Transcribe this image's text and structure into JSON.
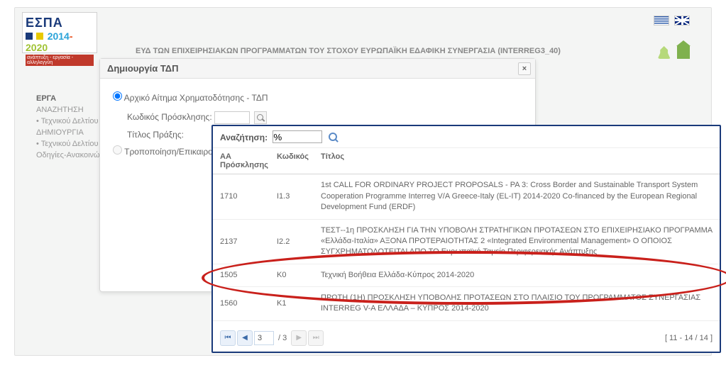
{
  "header": {
    "title": "ΕΥΔ ΤΩΝ ΕΠΙΧΕΙΡΗΣΙΑΚΩΝ ΠΡΟΓΡΑΜΜΑΤΩΝ ΤΟΥ ΣΤΟΧΟΥ ΕΥΡΩΠΑΪΚΗ ΕΔΑΦΙΚΗ ΣΥΝΕΡΓΑΣΙΑ (INTERREG3_40)",
    "logo_text": "ΕΣΠΑ",
    "logo_period": "2014-2020",
    "logo_tagline": "ανάπτυξη - εργασία - αλληλεγγύη"
  },
  "sidebar": {
    "heading": "ΕΡΓΑ",
    "items": [
      "ΑΝΑΖΗΤΗΣΗ",
      "• Τεχνικού Δελτίου",
      "ΔΗΜΙΟΥΡΓΙΑ",
      "• Τεχνικού Δελτίου",
      "Οδηγίες-Ανακοινώσ"
    ]
  },
  "modal": {
    "title": "Δημιουργία ΤΔΠ",
    "close": "×",
    "radio1": "Αρχικό Αίτημα Χρηματοδότησης - ΤΔΠ",
    "radio2": "Τροποποίηση/Επικαιροποί",
    "field_code": "Κωδικός Πρόσκλησης:",
    "field_title": "Τίτλος Πράξης:"
  },
  "search_popup": {
    "label": "Αναζήτηση:",
    "value": "%",
    "columns": {
      "aa": "ΑΑ Πρόσκλησης",
      "code": "Κωδικός",
      "title": "Τίτλος"
    },
    "rows": [
      {
        "aa": "1710",
        "code": "I1.3",
        "title": "1st CALL FOR ORDINARY PROJECT PROPOSALS - PA 3: Cross Border and Sustainable Transport System Cooperation Programme Interreg V/A Greece-Italy (EL-IT) 2014-2020 Co-financed by the European Regional Development Fund (ERDF)"
      },
      {
        "aa": "2137",
        "code": "I2.2",
        "title": "ΤΕΣΤ--1η ΠΡΟΣΚΛΗΣΗ ΓΙΑ ΤΗΝ ΥΠΟΒΟΛΗ ΣΤΡΑΤΗΓΙΚΩΝ ΠΡΟΤΑΣΕΩΝ ΣΤΟ ΕΠΙΧΕΙΡΗΣΙΑΚΟ ΠΡΟΓΡΑΜΜΑ «Ελλάδα-Ιταλία» ΑΞΟΝΑ ΠΡΟΤΕΡΑΙΟΤΗΤΑΣ 2 «Integrated Environmental Management» Ο ΟΠΟΙΟΣ ΣΥΓΧΡΗΜΑΤΟΔΟΤΕΙΤΑΙ ΑΠΟ ΤΟ Ευρωπαϊκό Ταμείο Περιφερειακής Ανάπτυξης"
      },
      {
        "aa": "1505",
        "code": "K0",
        "title": "Τεχνική Βοήθεια Ελλάδα-Κύπρος 2014-2020"
      },
      {
        "aa": "1560",
        "code": "K1",
        "title": "ΠΡΩΤΗ (1Η) ΠΡΟΣΚΛΗΣΗ ΥΠΟΒΟΛΗΣ ΠΡΟΤΑΣΕΩΝ ΣΤΟ ΠΛΑΙΣΙΟ ΤΟΥ ΠΡΟΓΡΑΜΜΑΤΟΣ ΣΥΝΕΡΓΑΣΙΑΣ INTERREG V-A ΕΛΛΑΔΑ – ΚΥΠΡΟΣ 2014-2020"
      }
    ],
    "pager": {
      "page": "3",
      "total": "/ 3",
      "range": "[ 11 - 14 / 14 ]"
    }
  }
}
